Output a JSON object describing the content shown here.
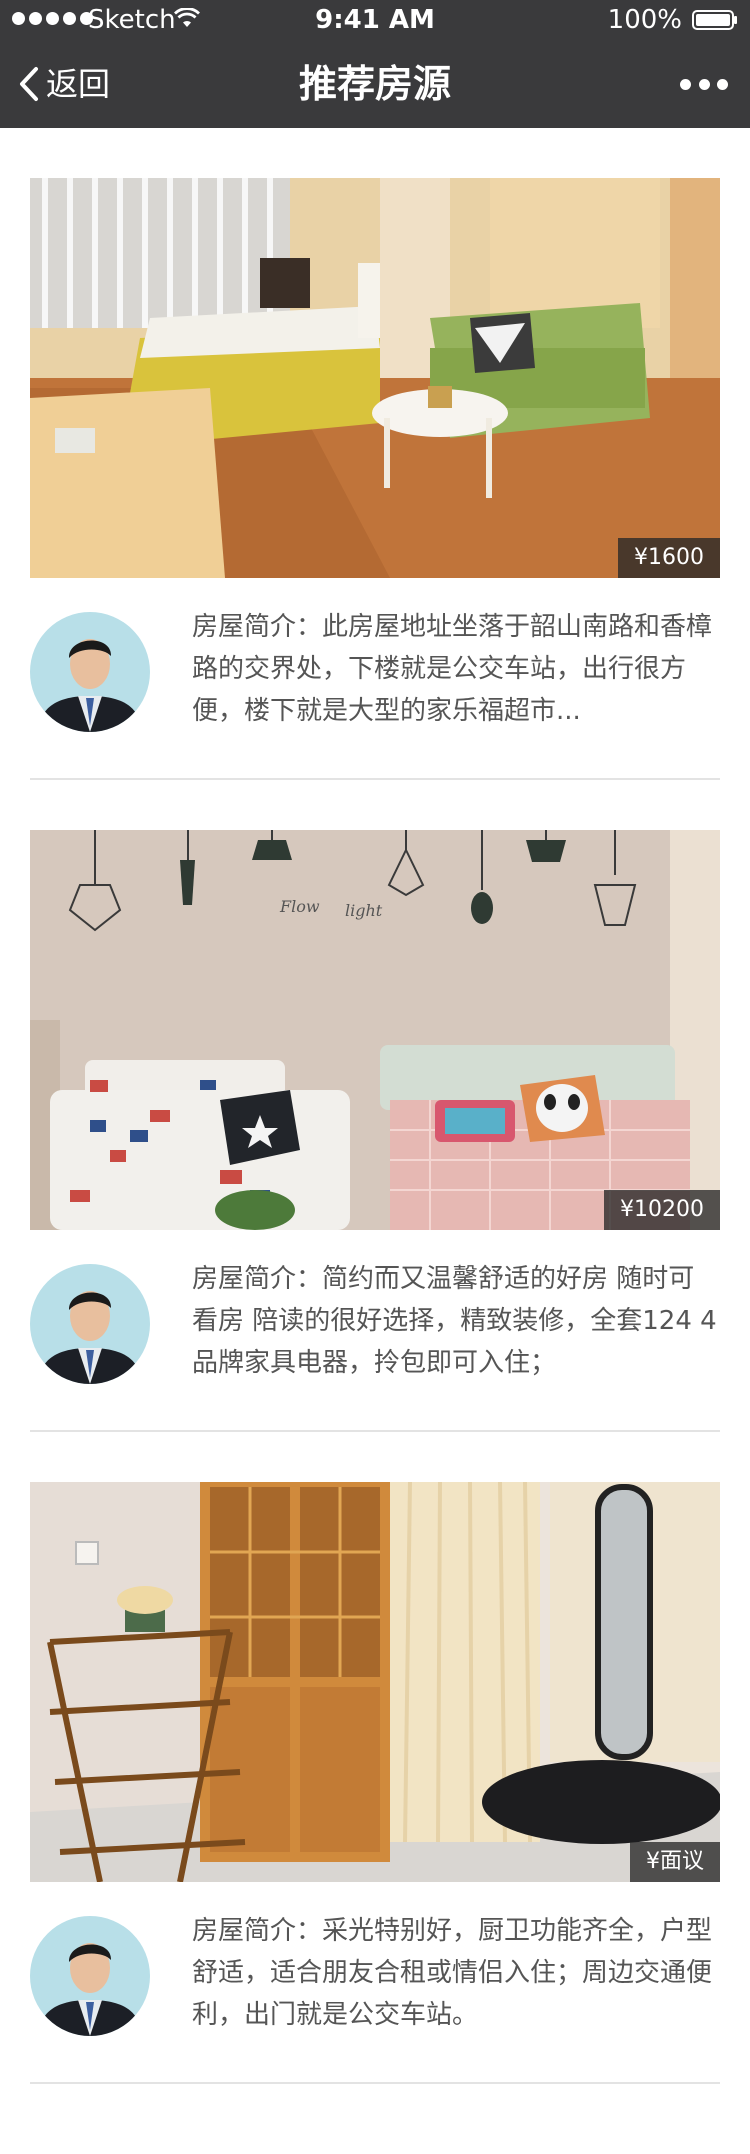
{
  "status_bar": {
    "carrier": "Sketch",
    "time": "9:41 AM",
    "battery": "100%"
  },
  "nav": {
    "back_label": "返回",
    "title": "推荐房源"
  },
  "colors": {
    "nav_background": "#3a3a3c",
    "divider": "#e3e3e3",
    "description_text": "#555555"
  },
  "listings": [
    {
      "price": "¥1600",
      "description": "房屋简介：此房屋地址坐落于韶山南路和香樟路的交界处，下楼就是公交车站，出行很方便，楼下就是大型的家乐福超市..."
    },
    {
      "price": "¥10200",
      "description": "房屋简介：简约而又温馨舒适的好房 随时可看房 陪读的很好选择，精致装修，全套124 4品牌家具电器，拎包即可入住；"
    },
    {
      "price": "¥面议",
      "description": "房屋简介：采光特别好，厨卫功能齐全，户型舒适，适合朋友合租或情侣入住；周边交通便利，出门就是公交车站。"
    }
  ]
}
